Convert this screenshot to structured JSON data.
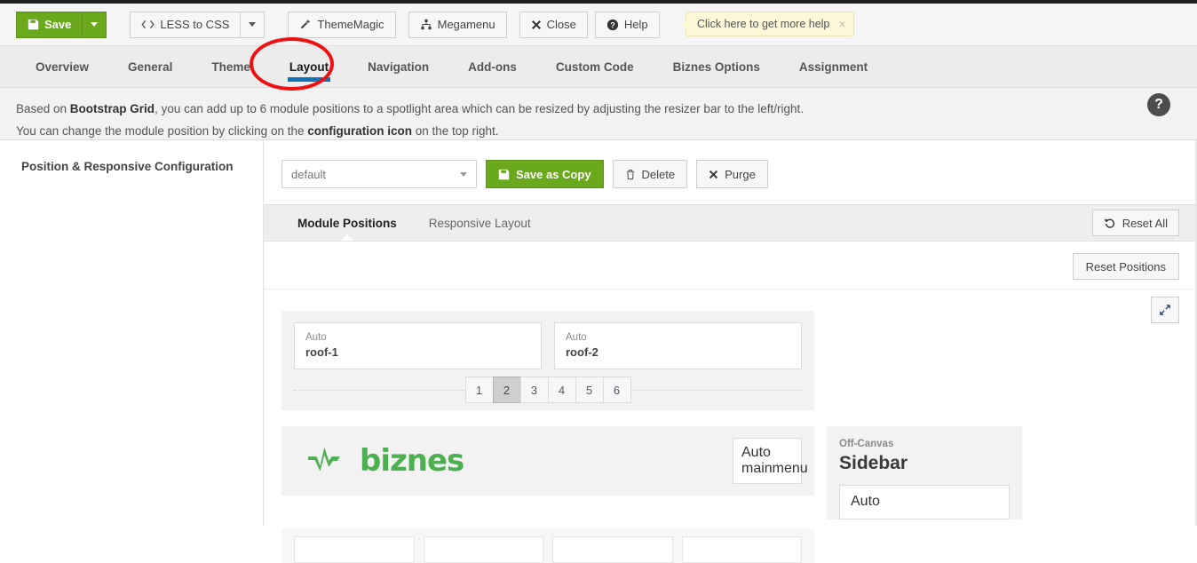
{
  "toolbar": {
    "save_label": "Save",
    "save_icon": "floppy-disk-icon",
    "less_to_css_label": "LESS to CSS",
    "less_icon": "code-icon",
    "thememagic_label": "ThemeMagic",
    "thememagic_icon": "magic-wand-icon",
    "megamenu_label": "Megamenu",
    "megamenu_icon": "sitemap-icon",
    "close_label": "Close",
    "close_icon": "x-icon",
    "help_label": "Help",
    "help_icon": "question-circle-icon",
    "tooltip_text": "Click here to get more help",
    "tooltip_close": "×"
  },
  "nav": {
    "tabs": [
      {
        "label": "Overview",
        "active": false
      },
      {
        "label": "General",
        "active": false
      },
      {
        "label": "Theme",
        "active": false
      },
      {
        "label": "Layout",
        "active": true
      },
      {
        "label": "Navigation",
        "active": false
      },
      {
        "label": "Add-ons",
        "active": false
      },
      {
        "label": "Custom Code",
        "active": false
      },
      {
        "label": "Biznes Options",
        "active": false
      },
      {
        "label": "Assignment",
        "active": false
      }
    ],
    "annotation_color": "#ee1111",
    "active_underline_color": "#1272b5"
  },
  "description": {
    "line1_a": "Based on ",
    "line1_b": "Bootstrap Grid",
    "line1_c": ", you can add up to 6 module positions to a spotlight area which can be resized by adjusting the resizer bar to the left/right.",
    "line2_a": "You can change the module position by clicking on the ",
    "line2_b": "configuration icon",
    "line2_c": " on the top right.",
    "help_icon": "question-mark-icon",
    "help_glyph": "?"
  },
  "sidebar_left": {
    "title": "Position & Responsive Configuration"
  },
  "config": {
    "preset_value": "default",
    "save_as_copy_label": "Save as Copy",
    "save_as_copy_icon": "floppy-disk-icon",
    "delete_label": "Delete",
    "delete_icon": "trash-icon",
    "purge_label": "Purge",
    "purge_icon": "x-icon",
    "expand_icon": "expand-arrows-icon",
    "accent_green": "#6aa81c"
  },
  "subtabs": {
    "items": [
      {
        "label": "Module Positions",
        "active": true
      },
      {
        "label": "Responsive Layout",
        "active": false
      }
    ],
    "reset_all_label": "Reset All",
    "reset_all_icon": "undo-icon",
    "reset_positions_label": "Reset Positions"
  },
  "layout": {
    "roof_row": {
      "boxes": [
        {
          "auto": "Auto",
          "position": "roof-1"
        },
        {
          "auto": "Auto",
          "position": "roof-2"
        }
      ],
      "pager": [
        "1",
        "2",
        "3",
        "4",
        "5",
        "6"
      ],
      "pager_active": "2"
    },
    "header_row": {
      "logo_text": "biznes",
      "logo_color": "#4caf50",
      "logo_icon": "pulse-wave-icon",
      "mainmenu": {
        "auto": "Auto",
        "position": "mainmenu"
      }
    },
    "offcanvas": {
      "label": "Off-Canvas",
      "title": "Sidebar",
      "box": {
        "auto": "Auto"
      }
    },
    "bottom_row": {
      "boxes": [
        "",
        "",
        "",
        ""
      ]
    }
  }
}
